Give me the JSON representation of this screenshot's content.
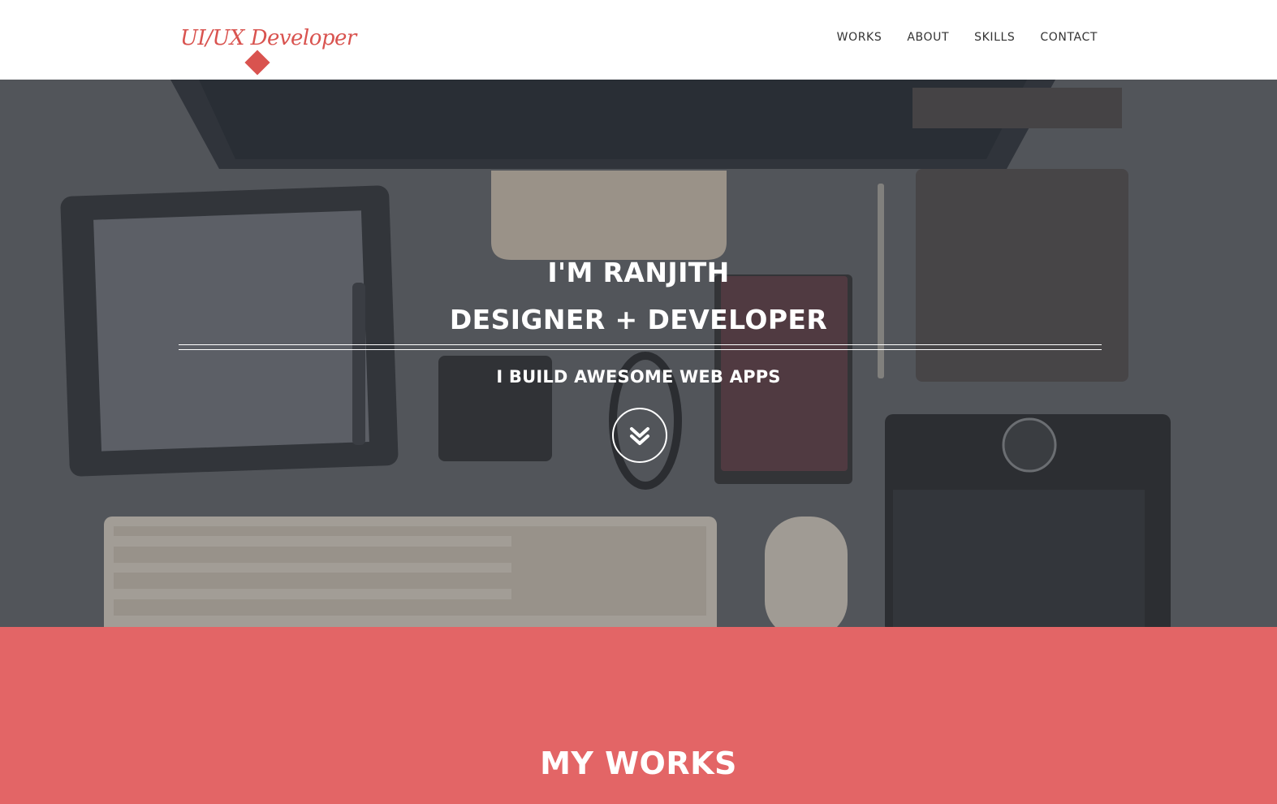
{
  "colors": {
    "accent": "#e36566",
    "logo_text": "#d9534f",
    "nav_text": "#333333",
    "hero_text": "#ffffff",
    "hero_overlay": "#5b5e62"
  },
  "header": {
    "logo_text": "UI/UX Developer",
    "logo_icon": "diamond-icon",
    "nav": [
      {
        "label": "WORKS"
      },
      {
        "label": "ABOUT"
      },
      {
        "label": "SKILLS"
      },
      {
        "label": "CONTACT"
      }
    ]
  },
  "hero": {
    "line1": "I'M RANJITH",
    "line2": "DESIGNER + DEVELOPER",
    "subtitle": "I BUILD AWESOME WEB APPS",
    "scroll_icon": "double-chevron-down-icon"
  },
  "works": {
    "title": "MY WORKS"
  }
}
